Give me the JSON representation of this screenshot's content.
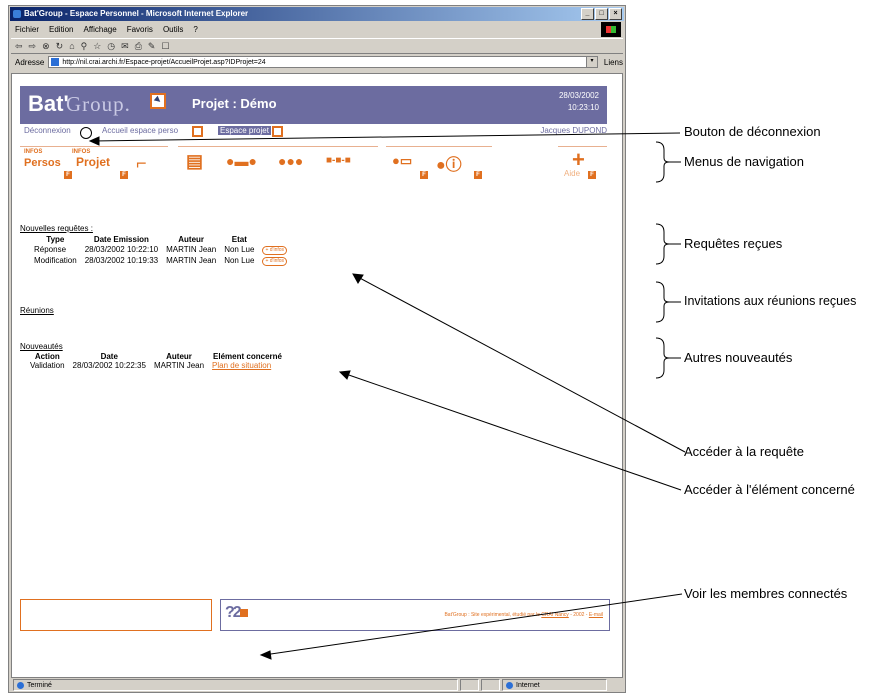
{
  "browser": {
    "title": "Bat'Group - Espace Personnel - Microsoft Internet Explorer",
    "menu": [
      "Fichier",
      "Edition",
      "Affichage",
      "Favoris",
      "Outils",
      "?"
    ],
    "address_label": "Adresse",
    "address_value": "http://nil.crai.archi.fr/Espace-projet/AccueilProjet.asp?IDProjet=24",
    "links_label": "Liens",
    "status_text": "Terminé",
    "zone_text": "Internet"
  },
  "site": {
    "logo_bat": "Bat'",
    "logo_group": "Group.",
    "project_title": "Projet : Démo",
    "date": "28/03/2002",
    "time": "10:23:10",
    "nav": {
      "logout": "Déconnexion",
      "home_perso": "Accueil espace perso",
      "project_space": "Espace projet",
      "user": "Jacques DUPOND"
    },
    "icons": {
      "persos": "Persos",
      "projet": "Projet",
      "aide": "Aide",
      "badge_letter": "F",
      "info_small": "INFOS"
    }
  },
  "requests": {
    "heading": "Nouvelles requêtes :",
    "columns": [
      "Type",
      "Date Emission",
      "Auteur",
      "Etat"
    ],
    "rows": [
      {
        "type": "Réponse",
        "date": "28/03/2002 10:22:10",
        "author": "MARTIN Jean",
        "state": "Non Lue",
        "button": "+ d'infos"
      },
      {
        "type": "Modification",
        "date": "28/03/2002 10:19:33",
        "author": "MARTIN Jean",
        "state": "Non Lue",
        "button": "+ d'infos"
      }
    ]
  },
  "meetings": {
    "heading": "Réunions"
  },
  "news": {
    "heading": "Nouveautés",
    "columns": [
      "Action",
      "Date",
      "Auteur",
      "Elément concerné"
    ],
    "rows": [
      {
        "action": "Validation",
        "date": "28/03/2002 10:22:35",
        "author": "MARTIN Jean",
        "element": "Plan de situation"
      }
    ]
  },
  "footer": {
    "members_icon_text": "?2",
    "text_prefix": "Bat'Group : Site expérimental, étudié par le",
    "crai_link": "CRAI Nancy",
    "text_year": "- 2002 -",
    "email_link": "E-mail"
  },
  "annotations": {
    "logout_button": "Bouton de déconnexion",
    "nav_menus": "Menus de navigation",
    "received_requests": "Requêtes reçues",
    "meeting_invitations": "Invitations aux réunions reçues",
    "other_news": "Autres nouveautés",
    "access_request": "Accéder à la requête",
    "access_element": "Accéder à l'élément concerné",
    "connected_members": "Voir les membres connectés"
  },
  "colors": {
    "accent_orange": "#e07020",
    "banner_purple": "#6c6ca0"
  }
}
